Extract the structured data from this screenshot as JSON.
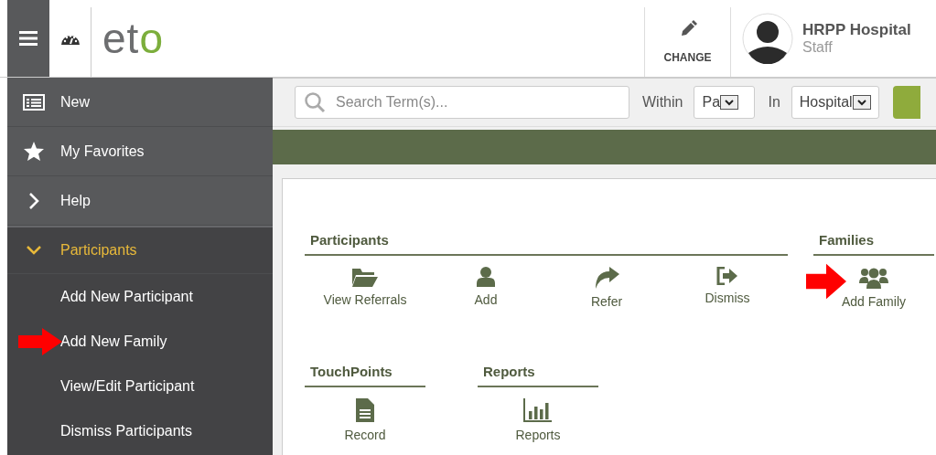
{
  "header": {
    "logo": {
      "text": "et",
      "accent": "o"
    },
    "change_label": "CHANGE",
    "user": {
      "name": "HRPP Hospital",
      "role": "Staff"
    }
  },
  "sidebar": {
    "items": [
      {
        "label": "New",
        "expanded": false
      },
      {
        "label": "My Favorites",
        "expanded": false
      },
      {
        "label": "Help",
        "expanded": false
      },
      {
        "label": "Participants",
        "expanded": true,
        "children": [
          {
            "label": "Add New Participant",
            "highlighted": false
          },
          {
            "label": "Add New Family",
            "highlighted": true
          },
          {
            "label": "View/Edit Participant",
            "highlighted": false
          },
          {
            "label": "Dismiss Participants",
            "highlighted": false
          }
        ]
      }
    ]
  },
  "search": {
    "placeholder": "Search Term(s)...",
    "within_label": "Within",
    "within_value": "Pa",
    "in_label": "In",
    "in_value": "Hospital"
  },
  "rows": [
    [
      {
        "title": "Participants",
        "actions": [
          {
            "label": "View Referrals",
            "highlighted": false
          },
          {
            "label": "Add",
            "highlighted": false
          },
          {
            "label": "Refer",
            "highlighted": false
          },
          {
            "label": "Dismiss",
            "highlighted": false
          }
        ]
      },
      {
        "title": "Families",
        "actions": [
          {
            "label": "Add Family",
            "highlighted": true
          }
        ]
      }
    ],
    [
      {
        "title": "TouchPoints",
        "actions": [
          {
            "label": "Record",
            "highlighted": false
          }
        ]
      },
      {
        "title": "Reports",
        "actions": [
          {
            "label": "Reports",
            "highlighted": false
          }
        ]
      }
    ]
  ]
}
